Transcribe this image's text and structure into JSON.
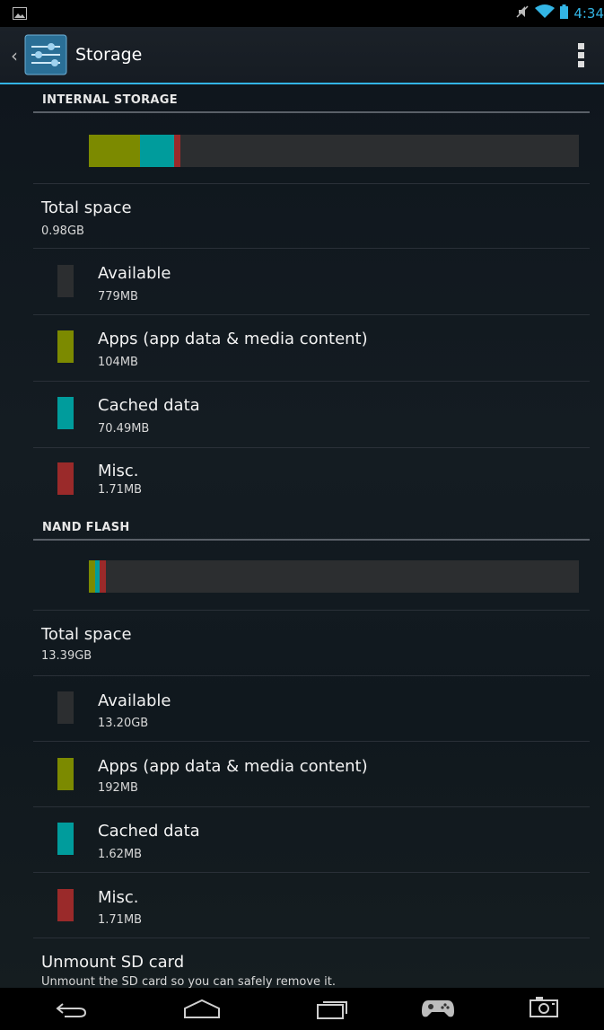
{
  "status_bar": {
    "time": "4:34",
    "icons": [
      "picture-icon",
      "mute-icon",
      "wifi-icon",
      "battery-icon"
    ]
  },
  "action_bar": {
    "title": "Storage",
    "icons": [
      "back-caret-icon",
      "settings-app-icon",
      "overflow-menu-icon"
    ]
  },
  "colors": {
    "accent": "#33b5e5",
    "available": "#2c2e30",
    "apps": "#7c8a00",
    "cached": "#009c9c",
    "misc": "#9a2a2a"
  },
  "sections": [
    {
      "header": "INTERNAL STORAGE",
      "bar_fractions": {
        "apps": 0.104,
        "cached": 0.07,
        "misc": 0.012
      },
      "total": {
        "label": "Total space",
        "value": "0.98GB"
      },
      "items": [
        {
          "key": "available",
          "label": "Available",
          "value": "779MB"
        },
        {
          "key": "apps",
          "label": "Apps (app data & media content)",
          "value": "104MB"
        },
        {
          "key": "cached",
          "label": "Cached data",
          "value": "70.49MB"
        },
        {
          "key": "misc",
          "label": "Misc.",
          "value": "1.71MB"
        }
      ]
    },
    {
      "header": "NAND FLASH",
      "bar_fractions": {
        "apps": 0.012,
        "cached": 0.01,
        "misc": 0.012
      },
      "total": {
        "label": "Total space",
        "value": "13.39GB"
      },
      "items": [
        {
          "key": "available",
          "label": "Available",
          "value": "13.20GB"
        },
        {
          "key": "apps",
          "label": "Apps (app data & media content)",
          "value": "192MB"
        },
        {
          "key": "cached",
          "label": "Cached data",
          "value": "1.62MB"
        },
        {
          "key": "misc",
          "label": "Misc.",
          "value": "1.71MB"
        }
      ]
    }
  ],
  "unmount": {
    "title": "Unmount SD card",
    "subtitle": "Unmount the SD card so you can safely remove it."
  },
  "nav_bar": {
    "buttons": [
      "back-icon",
      "home-icon",
      "recent-apps-icon",
      "gamepad-icon",
      "screenshot-icon"
    ]
  }
}
